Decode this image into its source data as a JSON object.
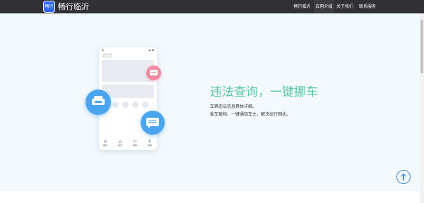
{
  "header": {
    "logo_text": "畅行",
    "brand": "畅行临沂",
    "nav": [
      {
        "label": "畅行临沂",
        "active": false
      },
      {
        "label": "应用介绍",
        "active": true
      },
      {
        "label": "关于我们",
        "active": false
      },
      {
        "label": "联系服务",
        "active": false
      }
    ]
  },
  "phone": {
    "status_left": "●",
    "status_right": "▪▪ ■",
    "title": "首页",
    "tabs": [
      {
        "icon": "home-icon",
        "label": "首页"
      },
      {
        "icon": "warning-icon",
        "label": "违法"
      },
      {
        "icon": "car-icon",
        "label": "挪车"
      },
      {
        "icon": "user-icon",
        "label": "我的"
      }
    ]
  },
  "feature": {
    "headline": "违法查询，一键挪车",
    "lines": [
      "车辆违法信息具体详细。",
      "爱车被挡，一键通知车主，解决出行困扰。"
    ]
  },
  "colors": {
    "accent_green": "#54c6a2",
    "accent_blue": "#4aa4ee",
    "pink": "#ef8aa0",
    "nav_bg": "#313135"
  }
}
